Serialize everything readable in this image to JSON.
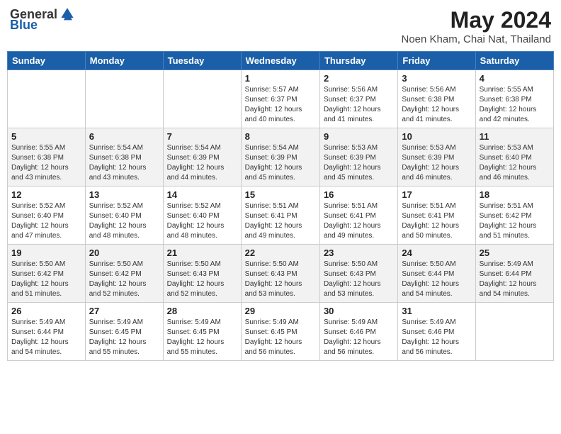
{
  "header": {
    "logo_general": "General",
    "logo_blue": "Blue",
    "month": "May 2024",
    "location": "Noen Kham, Chai Nat, Thailand"
  },
  "weekdays": [
    "Sunday",
    "Monday",
    "Tuesday",
    "Wednesday",
    "Thursday",
    "Friday",
    "Saturday"
  ],
  "weeks": [
    [
      {
        "day": "",
        "info": ""
      },
      {
        "day": "",
        "info": ""
      },
      {
        "day": "",
        "info": ""
      },
      {
        "day": "1",
        "info": "Sunrise: 5:57 AM\nSunset: 6:37 PM\nDaylight: 12 hours\nand 40 minutes."
      },
      {
        "day": "2",
        "info": "Sunrise: 5:56 AM\nSunset: 6:37 PM\nDaylight: 12 hours\nand 41 minutes."
      },
      {
        "day": "3",
        "info": "Sunrise: 5:56 AM\nSunset: 6:38 PM\nDaylight: 12 hours\nand 41 minutes."
      },
      {
        "day": "4",
        "info": "Sunrise: 5:55 AM\nSunset: 6:38 PM\nDaylight: 12 hours\nand 42 minutes."
      }
    ],
    [
      {
        "day": "5",
        "info": "Sunrise: 5:55 AM\nSunset: 6:38 PM\nDaylight: 12 hours\nand 43 minutes."
      },
      {
        "day": "6",
        "info": "Sunrise: 5:54 AM\nSunset: 6:38 PM\nDaylight: 12 hours\nand 43 minutes."
      },
      {
        "day": "7",
        "info": "Sunrise: 5:54 AM\nSunset: 6:39 PM\nDaylight: 12 hours\nand 44 minutes."
      },
      {
        "day": "8",
        "info": "Sunrise: 5:54 AM\nSunset: 6:39 PM\nDaylight: 12 hours\nand 45 minutes."
      },
      {
        "day": "9",
        "info": "Sunrise: 5:53 AM\nSunset: 6:39 PM\nDaylight: 12 hours\nand 45 minutes."
      },
      {
        "day": "10",
        "info": "Sunrise: 5:53 AM\nSunset: 6:39 PM\nDaylight: 12 hours\nand 46 minutes."
      },
      {
        "day": "11",
        "info": "Sunrise: 5:53 AM\nSunset: 6:40 PM\nDaylight: 12 hours\nand 46 minutes."
      }
    ],
    [
      {
        "day": "12",
        "info": "Sunrise: 5:52 AM\nSunset: 6:40 PM\nDaylight: 12 hours\nand 47 minutes."
      },
      {
        "day": "13",
        "info": "Sunrise: 5:52 AM\nSunset: 6:40 PM\nDaylight: 12 hours\nand 48 minutes."
      },
      {
        "day": "14",
        "info": "Sunrise: 5:52 AM\nSunset: 6:40 PM\nDaylight: 12 hours\nand 48 minutes."
      },
      {
        "day": "15",
        "info": "Sunrise: 5:51 AM\nSunset: 6:41 PM\nDaylight: 12 hours\nand 49 minutes."
      },
      {
        "day": "16",
        "info": "Sunrise: 5:51 AM\nSunset: 6:41 PM\nDaylight: 12 hours\nand 49 minutes."
      },
      {
        "day": "17",
        "info": "Sunrise: 5:51 AM\nSunset: 6:41 PM\nDaylight: 12 hours\nand 50 minutes."
      },
      {
        "day": "18",
        "info": "Sunrise: 5:51 AM\nSunset: 6:42 PM\nDaylight: 12 hours\nand 51 minutes."
      }
    ],
    [
      {
        "day": "19",
        "info": "Sunrise: 5:50 AM\nSunset: 6:42 PM\nDaylight: 12 hours\nand 51 minutes."
      },
      {
        "day": "20",
        "info": "Sunrise: 5:50 AM\nSunset: 6:42 PM\nDaylight: 12 hours\nand 52 minutes."
      },
      {
        "day": "21",
        "info": "Sunrise: 5:50 AM\nSunset: 6:43 PM\nDaylight: 12 hours\nand 52 minutes."
      },
      {
        "day": "22",
        "info": "Sunrise: 5:50 AM\nSunset: 6:43 PM\nDaylight: 12 hours\nand 53 minutes."
      },
      {
        "day": "23",
        "info": "Sunrise: 5:50 AM\nSunset: 6:43 PM\nDaylight: 12 hours\nand 53 minutes."
      },
      {
        "day": "24",
        "info": "Sunrise: 5:50 AM\nSunset: 6:44 PM\nDaylight: 12 hours\nand 54 minutes."
      },
      {
        "day": "25",
        "info": "Sunrise: 5:49 AM\nSunset: 6:44 PM\nDaylight: 12 hours\nand 54 minutes."
      }
    ],
    [
      {
        "day": "26",
        "info": "Sunrise: 5:49 AM\nSunset: 6:44 PM\nDaylight: 12 hours\nand 54 minutes."
      },
      {
        "day": "27",
        "info": "Sunrise: 5:49 AM\nSunset: 6:45 PM\nDaylight: 12 hours\nand 55 minutes."
      },
      {
        "day": "28",
        "info": "Sunrise: 5:49 AM\nSunset: 6:45 PM\nDaylight: 12 hours\nand 55 minutes."
      },
      {
        "day": "29",
        "info": "Sunrise: 5:49 AM\nSunset: 6:45 PM\nDaylight: 12 hours\nand 56 minutes."
      },
      {
        "day": "30",
        "info": "Sunrise: 5:49 AM\nSunset: 6:46 PM\nDaylight: 12 hours\nand 56 minutes."
      },
      {
        "day": "31",
        "info": "Sunrise: 5:49 AM\nSunset: 6:46 PM\nDaylight: 12 hours\nand 56 minutes."
      },
      {
        "day": "",
        "info": ""
      }
    ]
  ]
}
